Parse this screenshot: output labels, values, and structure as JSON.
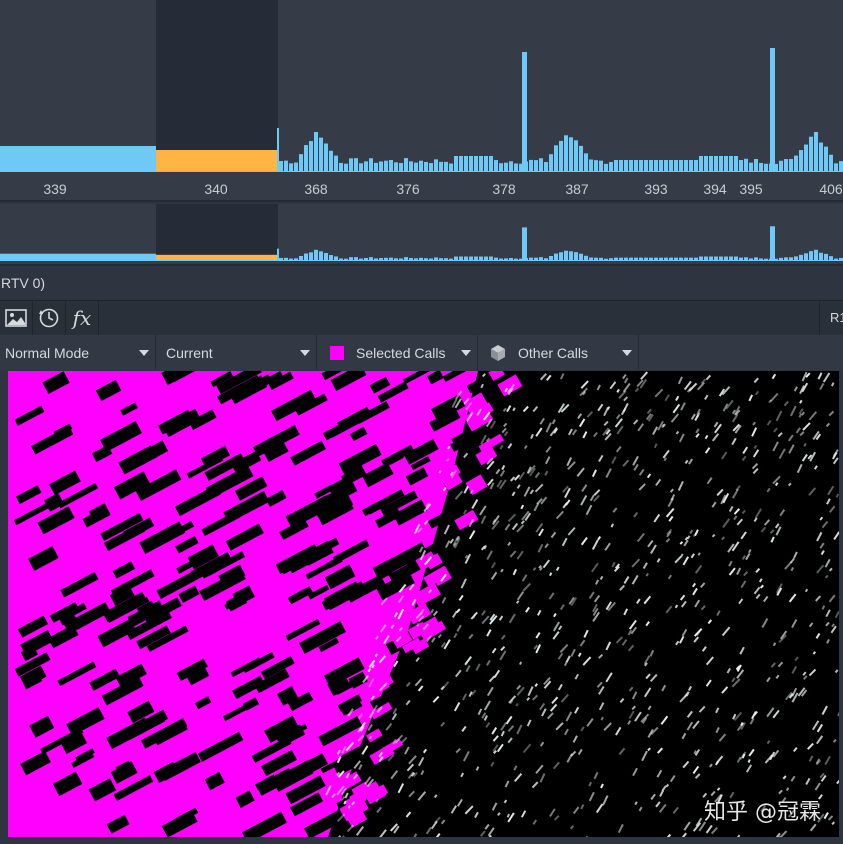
{
  "timeline": {
    "tick_labels": [
      "339",
      "340",
      "368",
      "376",
      "378",
      "387",
      "393",
      "394",
      "395",
      "406"
    ],
    "selected_label": "340",
    "bar_color": "#6fc9f7",
    "selected_color": "#ffb443",
    "selection_bg": "#262c37"
  },
  "status": {
    "text": "RTV 0)"
  },
  "toolbar": {
    "buttons": [
      {
        "icon": "image-icon"
      },
      {
        "icon": "history-icon"
      },
      {
        "icon": "fx-icon",
        "label": "fx"
      }
    ],
    "right_text": "R1"
  },
  "controls": {
    "mode": "Normal Mode",
    "source": "Current",
    "selected_calls": {
      "label": "Selected Calls",
      "color": "#ff00ff"
    },
    "other_calls": {
      "label": "Other Calls",
      "icon": "cube-icon"
    }
  },
  "viewport": {
    "selected_color": "#ff00ff",
    "other_color": "#e8f0f0"
  },
  "watermark": "知乎 @冠霖"
}
